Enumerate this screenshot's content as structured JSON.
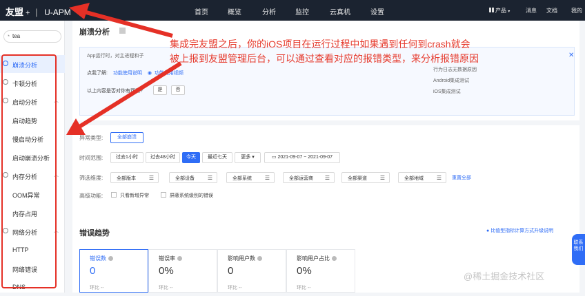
{
  "topbar": {
    "brand": "友盟",
    "brand_plus": "+",
    "product": "U-APM",
    "nav": [
      "首页",
      "概览",
      "分析",
      "监控",
      "云真机",
      "设置"
    ],
    "right": [
      "产品",
      "消息",
      "文档",
      "我的"
    ]
  },
  "sidebar": {
    "app_name": "tea",
    "items": [
      {
        "label": "崩溃分析",
        "icon": "crash-icon"
      },
      {
        "label": "卡顿分析",
        "icon": "lag-icon"
      },
      {
        "label": "启动分析",
        "icon": "launch-icon"
      },
      {
        "label": "启动趋势"
      },
      {
        "label": "慢启动分析"
      },
      {
        "label": "启动崩溃分析"
      },
      {
        "label": "内存分析",
        "icon": "memory-icon"
      },
      {
        "label": "OOM异常"
      },
      {
        "label": "内存占用"
      },
      {
        "label": "网络分析",
        "icon": "network-icon"
      },
      {
        "label": "HTTP"
      },
      {
        "label": "网络错误"
      },
      {
        "label": "DNS"
      }
    ]
  },
  "main": {
    "title": "崩溃分析",
    "info": {
      "text_line1": "App运行时，对主进程和子",
      "learn_label": "点我了解:",
      "learn_link1": "功能使用说明",
      "learn_link2": "功能使用视频",
      "ask": "以上内容是否对你有帮助?",
      "yes": "是",
      "no": "否",
      "right_list": [
        "行为日志无数据原因",
        "Android集成测试",
        "iOS集成测试"
      ]
    },
    "filters": {
      "type_label": "异常类型:",
      "type_value": "全部崩溃",
      "time_label": "时间范围:",
      "time_options": [
        "过去1小时",
        "过去48小时",
        "今天",
        "最近七天",
        "更多"
      ],
      "date_range": "2021-09-07 ~ 2021-09-07",
      "dim_label": "筛选维度:",
      "dims": [
        "全部版本",
        "全部设备",
        "全部系统",
        "全部运营商",
        "全部渠道",
        "全部地域"
      ],
      "reset": "重置全部",
      "adv_label": "高级功能:",
      "adv_options": [
        "只看新增异常",
        "屏蔽系统级别的错误"
      ]
    },
    "trend": {
      "title": "错误趋势",
      "note": "比值型指标计算方式升级说明",
      "cards": [
        {
          "label": "错误数",
          "value": "0",
          "hint": "环比  --"
        },
        {
          "label": "错误率",
          "value": "0%",
          "hint": "环比  --"
        },
        {
          "label": "影响用户数",
          "value": "0",
          "hint": "环比  --"
        },
        {
          "label": "影响用户占比",
          "value": "0%",
          "hint": "环比  --"
        }
      ]
    }
  },
  "floater": "联系我们",
  "annotation": {
    "line1": "集成完友盟之后，你的iOS项目在运行过程中如果遇到任何到crash就会",
    "line2": "被上报到友盟管理后台，可以通过查看对应的报错类型，来分析报错原因"
  },
  "watermark": "@稀土掘金技术社区",
  "colors": {
    "accent": "#2f6df6",
    "topbar": "#1b2330",
    "annotation": "#e63b2e"
  }
}
